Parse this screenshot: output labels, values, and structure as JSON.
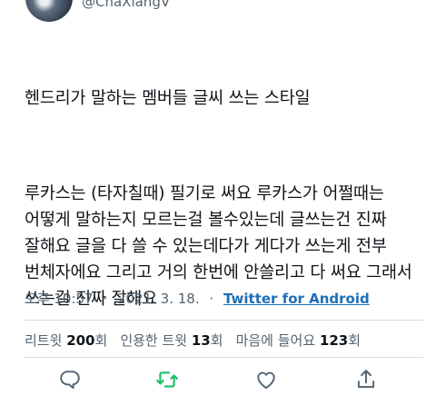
{
  "author": {
    "handle": "@ChaXiangV"
  },
  "tweet": {
    "line_title": "헨드리가 말하는 멤버들 글씨 쓰는 스타일",
    "body": "루카스는 (타자칠때) 필기로 써요 루카스가 어쩔때는 어떻게 말하는지 모르는걸 볼수있는데 글쓰는건 진짜 잘해요 글을 다 쓸 수 있는데다가 게다가 쓰는게 전부 번체자에요 그리고 거의 한번에 안쓸리고 다 써요 그래서 쓰는걸 진짜 잘해요"
  },
  "meta": {
    "time": "오후 10:57",
    "date": "2021. 3. 18.",
    "separator": "·",
    "source": "Twitter for Android"
  },
  "stats": {
    "retweets_label": "리트윗",
    "retweets": "200",
    "quotes_label": "인용한 트윗",
    "quotes": "13",
    "likes_label": "마음에 들어요",
    "likes": "123",
    "unit": "회"
  },
  "icons": {
    "reply": "reply-icon",
    "retweet": "retweet-icon",
    "like": "heart-icon",
    "share": "share-icon"
  },
  "colors": {
    "retweet_accent": "#17bf63",
    "link": "#1d6fb8",
    "icon_gray": "#536471"
  }
}
